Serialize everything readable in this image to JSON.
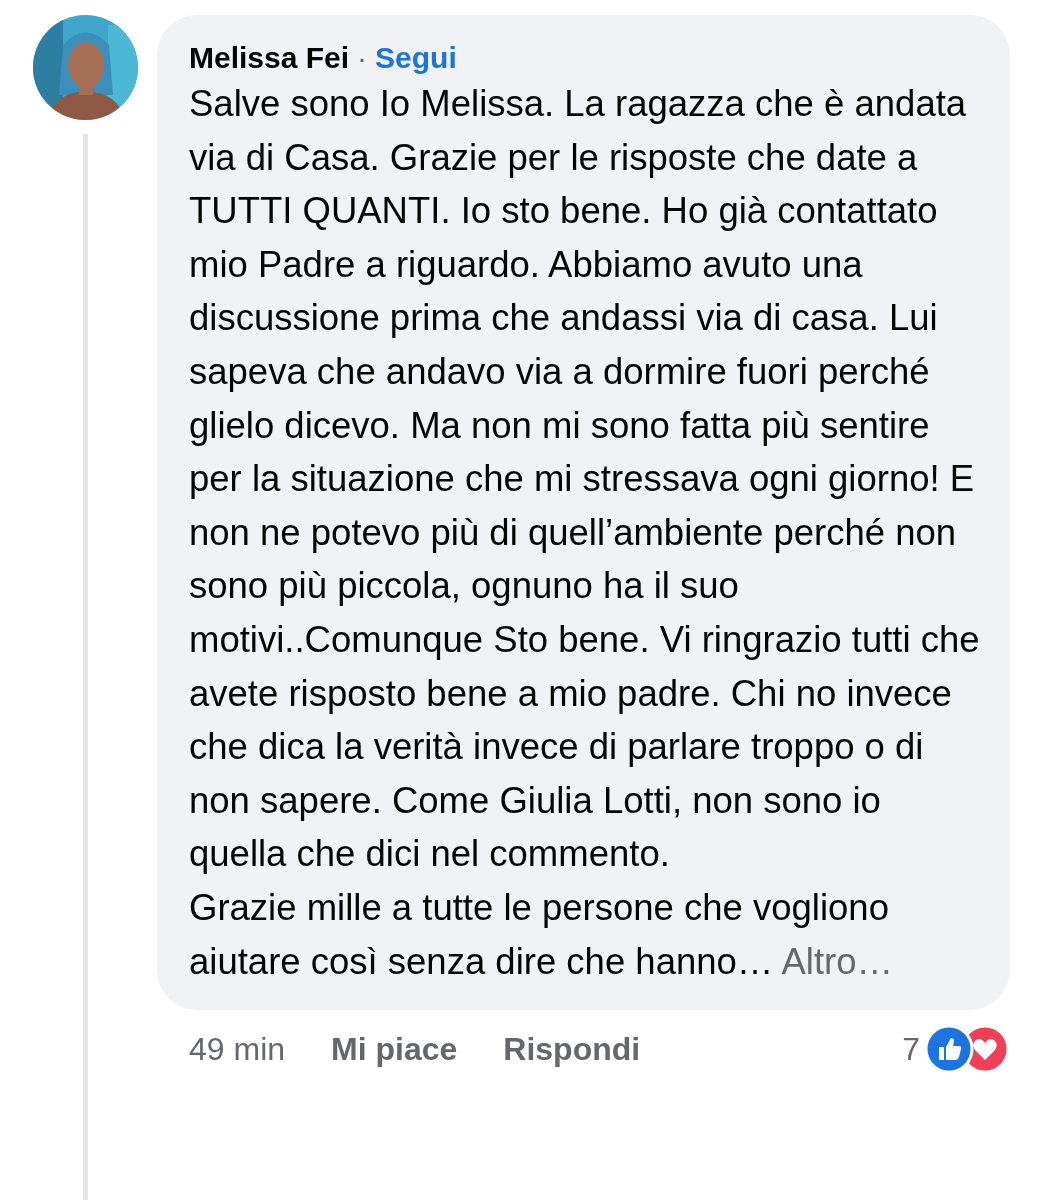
{
  "comment": {
    "author": "Melissa Fei",
    "separator": "·",
    "follow": "Segui",
    "paragraphs": [
      "Salve sono Io Melissa. La ragazza che è andata via di Casa. Grazie per le risposte che date a TUTTI QUANTI. Io sto bene. Ho già contattato mio Padre a riguardo. Abbiamo avuto una discussione prima che andassi via di casa. Lui sapeva che andavo via a dormire fuori perché glielo dicevo. Ma non mi sono fatta più sentire per la situazione che mi stressava ogni giorno! E non ne potevo più di quell’ambiente perché non sono più piccola, ognuno ha il suo motivi..Comunque Sto bene. Vi ringrazio tutti che avete risposto bene a mio padre. Chi no invece che dica la verità invece di parlare troppo o di non sapere. Come Giulia Lotti, non sono io quella che dici nel commento.",
      "Grazie mille a tutte le persone che vogliono aiutare così senza dire che hanno…"
    ],
    "more": "Altro…",
    "time": "49 min",
    "actions": [
      "Mi piace",
      "Rispondi"
    ],
    "reaction_count": "7"
  }
}
